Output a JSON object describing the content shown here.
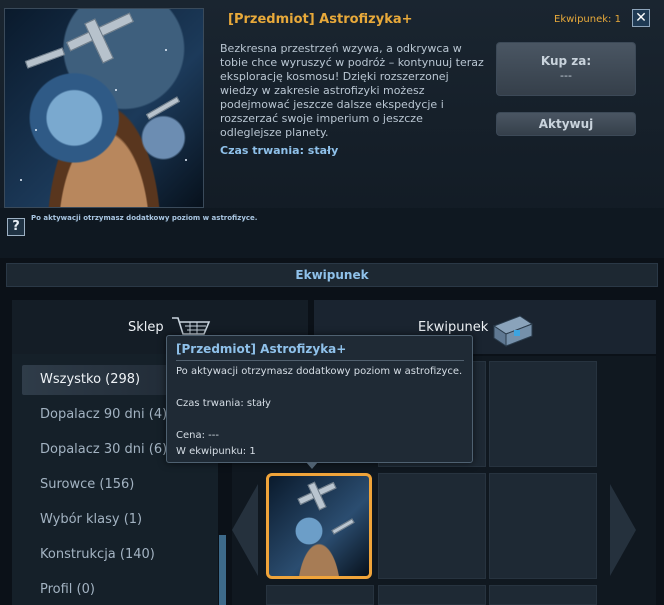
{
  "detail": {
    "title": "[Przedmiot] Astrofizyka+",
    "owned": "Ekwipunek: 1",
    "close_icon": "close-icon",
    "description": "Bezkresna przestrzeń wzywa, a odkrywca w tobie chce wyruszyć w podróż – kontynuuj teraz eksplorację kosmosu! Dzięki rozszerzonej wiedzy w zakresie astrofizyki możesz podejmować jeszcze dalsze ekspedycje i rozszerzać swoje imperium o jeszcze odleglejsze planety.",
    "duration": "Czas trwania: stały",
    "buy_label": "Kup za:",
    "buy_price": "---",
    "activate_label": "Aktywuj",
    "help_icon": "?",
    "help_text": "Po aktywacji otrzymasz dodatkowy poziom w astrofizyce."
  },
  "equipment_header": "Ekwipunek",
  "tabs": {
    "shop": "Sklep",
    "inventory": "Ekwipunek"
  },
  "categories": [
    "Wszystko (298)",
    "Dopalacz 90 dni (4)",
    "Dopalacz 30 dni (6)",
    "Surowce (156)",
    "Wybór klasy (1)",
    "Konstrukcja (140)",
    "Profil (0)"
  ],
  "tooltip": {
    "title": "[Przedmiot] Astrofizyka+",
    "text": "Po aktywacji otrzymasz dodatkowy poziom w astrofizyce.",
    "duration": "Czas trwania: stały",
    "price": "Cena: ---",
    "owned": "W ekwipunku: 1"
  },
  "colors": {
    "accent": "#e8a93a",
    "link": "#8fc1ea",
    "background": "#0b1118"
  }
}
